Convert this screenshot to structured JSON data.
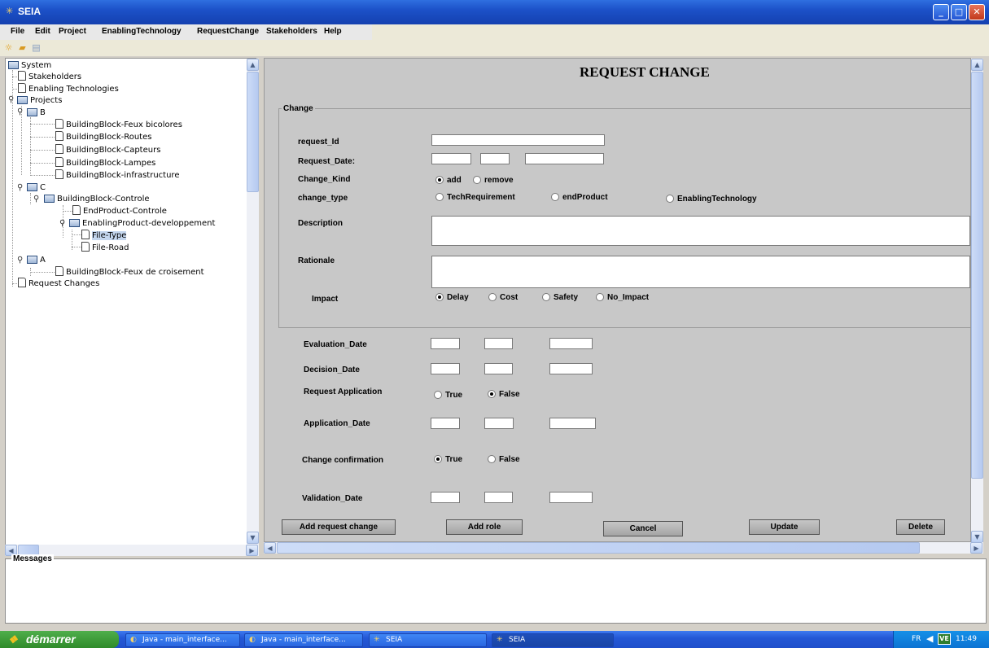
{
  "window": {
    "title": "SEIA",
    "icon": "app-icon"
  },
  "menu": [
    "File",
    "Edit",
    "Project",
    "EnablingTechnology",
    "RequestChange",
    "Stakeholders",
    "Help"
  ],
  "toolbar_icons": [
    "new-icon",
    "open-folder-icon",
    "paste-icon"
  ],
  "tree": {
    "root": "System",
    "items": {
      "stakeholders": "Stakeholders",
      "enabling": "Enabling Technologies",
      "projects": "Projects",
      "b": "B",
      "b1": "BuildingBlock-Feux bicolores",
      "b2": "BuildingBlock-Routes",
      "b3": "BuildingBlock-Capteurs",
      "b4": "BuildingBlock-Lampes",
      "b5": "BuildingBlock-infrastructure",
      "c": "C",
      "c1": "BuildingBlock-Controle",
      "c1a": "EndProduct-Controle",
      "c1b": "EnablingProduct-developpement",
      "c1b1": "File-Type",
      "c1b2": "File-Road",
      "a": "A",
      "a1": "BuildingBlock-Feux de croisement",
      "requests": "Request Changes"
    }
  },
  "form": {
    "title": "REQUEST CHANGE",
    "group_label": "Change",
    "labels": {
      "request_id": "request_Id",
      "request_date": "Request_Date:",
      "change_kind": "Change_Kind",
      "change_type": "change_type",
      "description": "Description",
      "rationale": "Rationale",
      "impact": "Impact",
      "evaluation_date": "Evaluation_Date",
      "decision_date": "Decision_Date",
      "request_application": "Request Application",
      "application_date": "Application_Date",
      "change_confirmation": "Change confirmation",
      "validation_date": "Validation_Date"
    },
    "change_kind_options": {
      "add": "add",
      "remove": "remove",
      "selected": "add"
    },
    "change_type_options": {
      "tech": "TechRequirement",
      "end": "endProduct",
      "enabling": "EnablingTechnology",
      "selected": ""
    },
    "impact_options": {
      "delay": "Delay",
      "cost": "Cost",
      "safety": "Safety",
      "none": "No_Impact",
      "selected": "Delay"
    },
    "request_application_options": {
      "true": "True",
      "false": "False",
      "selected": "False"
    },
    "change_confirmation_options": {
      "true": "True",
      "false": "False",
      "selected": "True"
    },
    "values": {
      "request_id": "",
      "description": "",
      "rationale": ""
    },
    "buttons": {
      "add_request": "Add request change",
      "add_role": "Add role",
      "cancel": "Cancel",
      "update": "Update",
      "delete": "Delete"
    }
  },
  "messages": {
    "label": "Messages",
    "content": ""
  },
  "taskbar": {
    "start": "démarrer",
    "tasks": [
      "Java - main_interface...",
      "Java - main_interface...",
      "SEIA",
      "SEIA"
    ],
    "tray": {
      "lang": "FR",
      "time": "11:49",
      "badge": "VE"
    }
  },
  "colors": {
    "title_bar": "#1c51c8",
    "form_bg": "#c8c8c8",
    "taskbar": "#2458d6",
    "start": "#2f8b2a"
  }
}
